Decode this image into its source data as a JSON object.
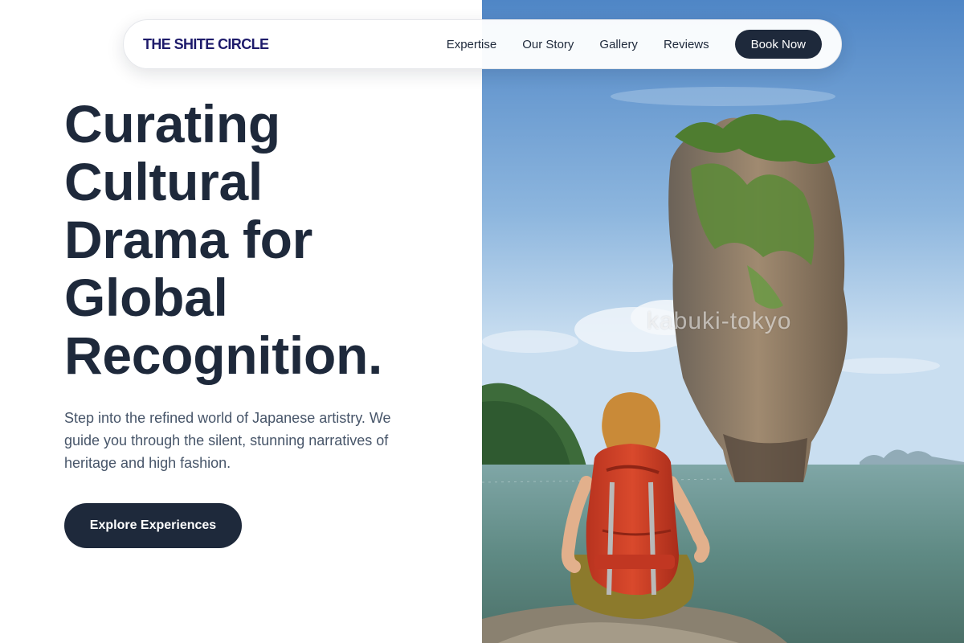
{
  "nav": {
    "brand": "THE SHITE CIRCLE",
    "links": [
      "Expertise",
      "Our Story",
      "Gallery",
      "Reviews"
    ],
    "book_label": "Book Now"
  },
  "hero": {
    "title_lines": [
      "Curating",
      "Cultural",
      "Drama for",
      "Global",
      "Recognition."
    ],
    "subtitle": "Step into the refined world of Japanese artistry. We guide you through the silent, stunning narratives of heritage and high fashion.",
    "cta_label": "Explore Experiences"
  },
  "image": {
    "watermark": "kabuki-tokyo",
    "subject": "hiker with red backpack sitting on rock facing limestone sea stack"
  },
  "colors": {
    "primary_dark": "#1e293b",
    "brand_navy": "#1e1b6b",
    "body_text": "#475569",
    "background": "#ffffff"
  }
}
